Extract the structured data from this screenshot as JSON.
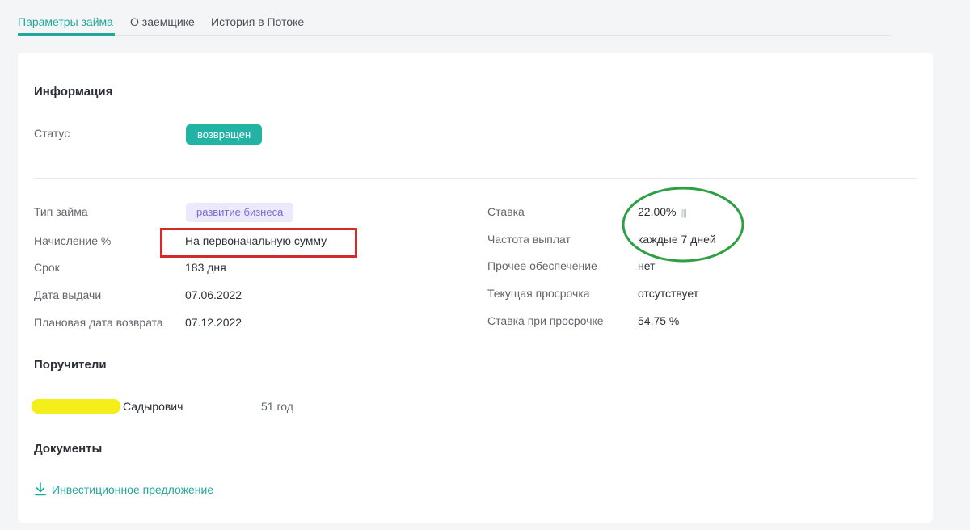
{
  "tabs": [
    {
      "label": "Параметры займа",
      "active": true
    },
    {
      "label": "О заемщике",
      "active": false
    },
    {
      "label": "История в Потоке",
      "active": false
    }
  ],
  "info": {
    "title": "Информация",
    "status_label": "Статус",
    "status_value": "возвращен"
  },
  "left_params": [
    {
      "label": "Тип займа",
      "value": "развитие бизнеса"
    },
    {
      "label": "Начисление %",
      "value": "На первоначальную сумму"
    },
    {
      "label": "Срок",
      "value": "183 дня"
    },
    {
      "label": "Дата выдачи",
      "value": "07.06.2022"
    },
    {
      "label": "Плановая дата возврата",
      "value": "07.12.2022"
    }
  ],
  "right_params": [
    {
      "label": "Ставка",
      "value": "22.00%"
    },
    {
      "label": "Частота выплат",
      "value": "каждые 7 дней"
    },
    {
      "label": "Прочее обеспечение",
      "value": "нет"
    },
    {
      "label": "Текущая просрочка",
      "value": "отсутствует"
    },
    {
      "label": "Ставка при просрочке",
      "value": "54.75 %"
    }
  ],
  "guarantors": {
    "title": "Поручители",
    "items": [
      {
        "name": "Садырович",
        "age": "51 год"
      }
    ]
  },
  "documents": {
    "title": "Документы",
    "items": [
      {
        "label": "Инвестиционное предложение",
        "icon": "download-icon"
      }
    ]
  },
  "colors": {
    "accent": "#21a89a",
    "status_badge": "#23b3a5",
    "type_badge_bg": "#ebe9fb",
    "type_badge_text": "#7a6ad3",
    "annotation_red": "#d32a2a",
    "annotation_green": "#2ea043",
    "redaction_yellow": "#f4ee1a"
  }
}
